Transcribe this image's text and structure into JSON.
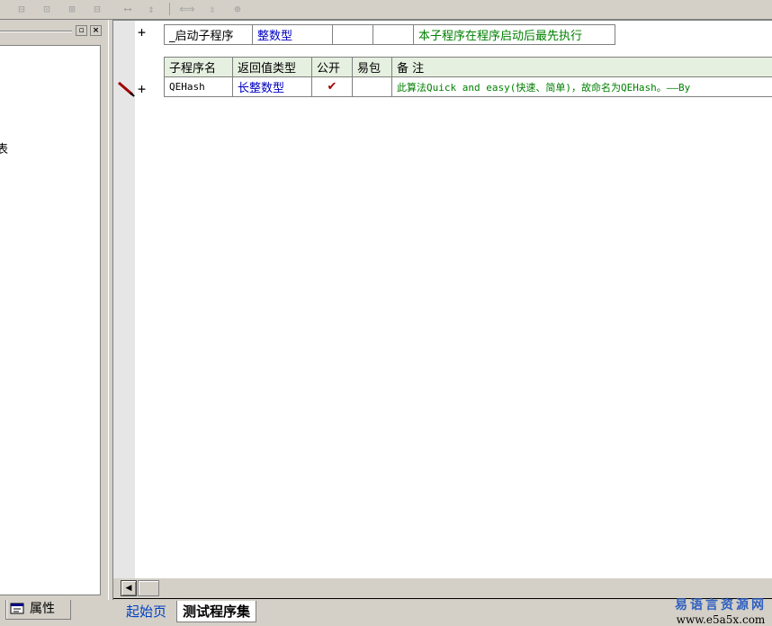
{
  "toolbar": {
    "buttons": [
      {
        "icon": "align-left-icon",
        "glyph": "⊟"
      },
      {
        "icon": "align-center-icon",
        "glyph": "⊡"
      },
      {
        "icon": "align-top-icon",
        "glyph": "⊞"
      },
      {
        "icon": "align-bottom-icon",
        "glyph": "⊟"
      },
      {
        "icon": "same-width-icon",
        "glyph": "⟷"
      },
      {
        "icon": "same-height-icon",
        "glyph": "⇕"
      },
      {
        "icon": "center-horizontal-icon",
        "glyph": "⟺"
      },
      {
        "icon": "center-vertical-icon",
        "glyph": "⇳"
      },
      {
        "icon": "center-both-icon",
        "glyph": "⊕"
      }
    ]
  },
  "left_panel": {
    "partial_text": "表",
    "properties_tab": "属性"
  },
  "startup_row": {
    "name": "_启动子程序",
    "type": "整数型",
    "public": "",
    "ebag": "",
    "remark": "本子程序在程序启动后最先执行"
  },
  "sub_table": {
    "headers": [
      "子程序名",
      "返回值类型",
      "公开",
      "易包",
      "备 注"
    ],
    "rows": [
      {
        "name": "QEHash",
        "type": "长整数型",
        "public": "✔",
        "ebag": "",
        "remark": "此算法Quick and easy(快速、简单)，故命名为QEHash。——By"
      }
    ]
  },
  "tabs": {
    "home": "起始页",
    "active": "测试程序集"
  },
  "watermark": {
    "cn": "易语言资源网",
    "url": "www.e5a5x.com"
  },
  "colors": {
    "keyword_blue": "#0000c0",
    "remark_green": "#008000",
    "check_red": "#a00000"
  }
}
